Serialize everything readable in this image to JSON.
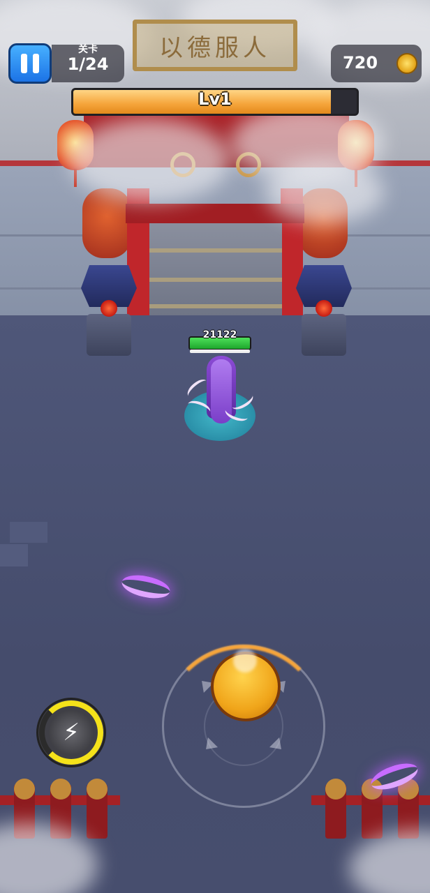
{
  "hud": {
    "level_title": "关卡",
    "level_value": "1/24",
    "coins": "720",
    "xp_label": "Lv1",
    "xp_progress": 0.91
  },
  "scene": {
    "gate_sign": "以德服人"
  },
  "hero": {
    "hp": "21122",
    "hp_progress": 1.0
  },
  "skill": {
    "cooldown_progress": 0.75
  },
  "icons": {
    "pause": "pause-icon",
    "coin": "coin-icon",
    "skill": "lightning-skill-icon"
  },
  "colors": {
    "xp_fill": "#f5a43a",
    "hp_fill": "#34c63e",
    "pause_button": "#2b8cf2",
    "projectile": "#c86cff"
  }
}
